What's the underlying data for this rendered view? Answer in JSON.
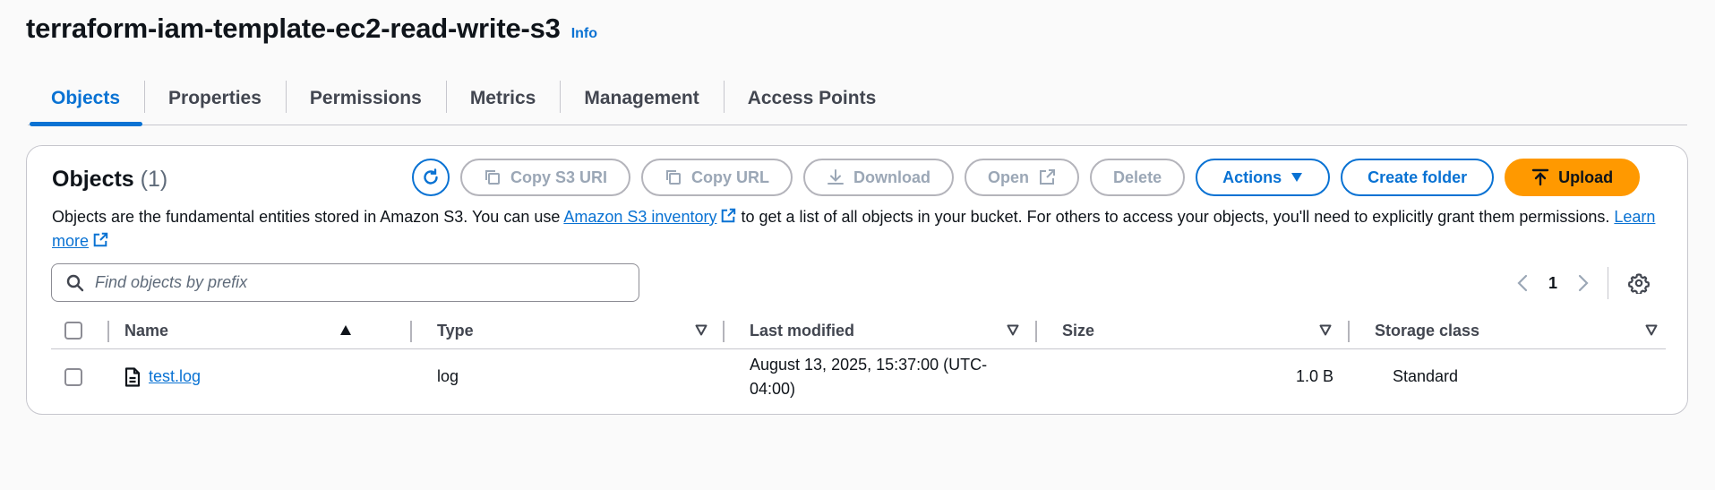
{
  "header": {
    "title": "terraform-iam-template-ec2-read-write-s3",
    "info_label": "Info"
  },
  "tabs": [
    {
      "label": "Objects",
      "active": true
    },
    {
      "label": "Properties"
    },
    {
      "label": "Permissions"
    },
    {
      "label": "Metrics"
    },
    {
      "label": "Management"
    },
    {
      "label": "Access Points"
    }
  ],
  "objects_panel": {
    "title": "Objects",
    "count": "(1)",
    "toolbar": {
      "refresh_icon": "refresh-icon",
      "copy_s3_uri": "Copy S3 URI",
      "copy_url": "Copy URL",
      "download": "Download",
      "open": "Open",
      "delete": "Delete",
      "actions": "Actions",
      "create_folder": "Create folder",
      "upload": "Upload"
    },
    "description": {
      "before_link": "Objects are the fundamental entities stored in Amazon S3. You can use ",
      "inventory_link": "Amazon S3 inventory",
      "after_link": " to get a list of all objects in your bucket. For others to access your objects, you'll need to explicitly grant them permissions. ",
      "learn_more": "Learn more"
    },
    "search": {
      "placeholder": "Find objects by prefix",
      "value": ""
    },
    "pagination": {
      "current_page": "1"
    },
    "table": {
      "columns": [
        "Name",
        "Type",
        "Last modified",
        "Size",
        "Storage class"
      ],
      "rows": [
        {
          "name": "test.log",
          "type": "log",
          "last_modified": "August 13, 2025, 15:37:00 (UTC-04:00)",
          "size": "1.0 B",
          "storage_class": "Standard"
        }
      ]
    }
  },
  "colors": {
    "accent": "#0972d3",
    "upload": "#ff9900",
    "disabled": "#9ba7b6",
    "text": "#0f141a"
  }
}
